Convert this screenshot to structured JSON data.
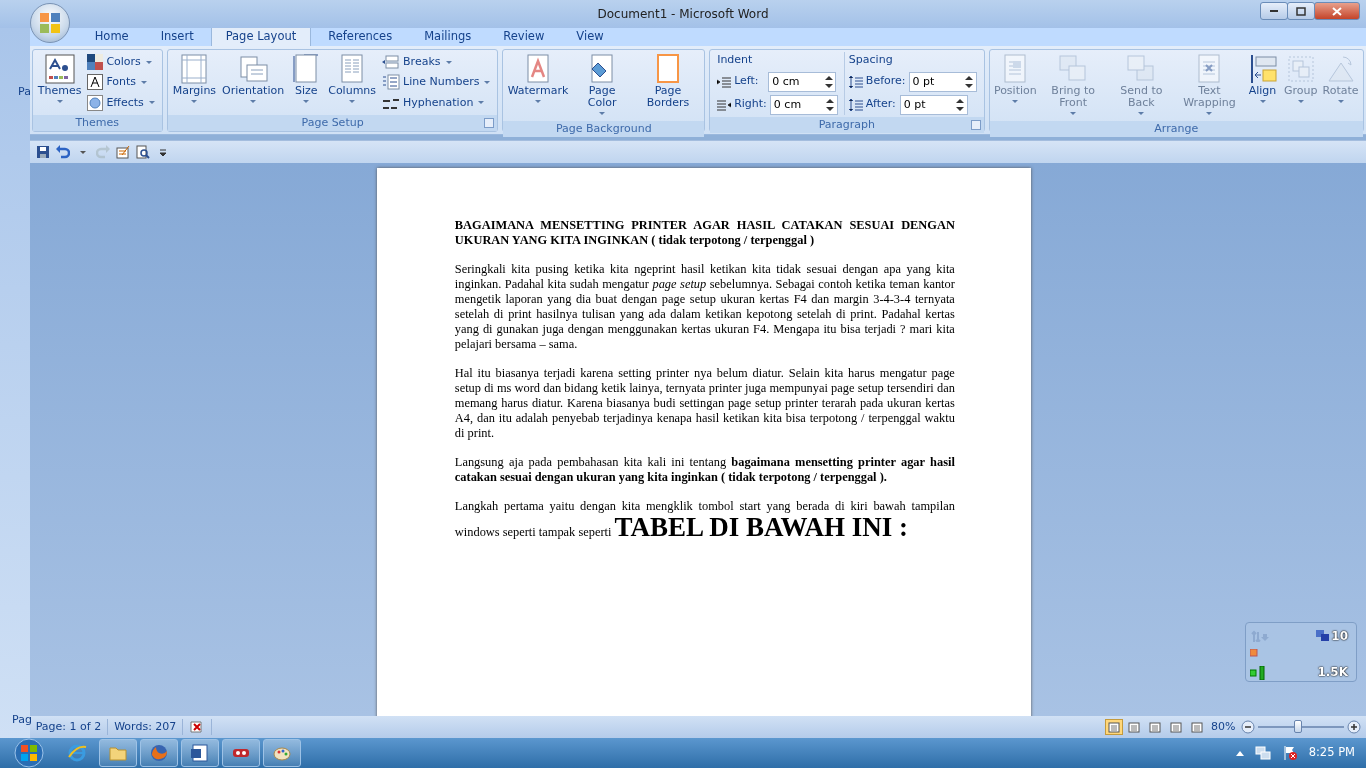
{
  "window": {
    "title": "Document1 - Microsoft Word"
  },
  "background_window": {
    "ribbon_text": "Pa",
    "status_text": "Pag"
  },
  "tabs": [
    {
      "label": "Home",
      "selected": false
    },
    {
      "label": "Insert",
      "selected": false
    },
    {
      "label": "Page Layout",
      "selected": true
    },
    {
      "label": "References",
      "selected": false
    },
    {
      "label": "Mailings",
      "selected": false
    },
    {
      "label": "Review",
      "selected": false
    },
    {
      "label": "View",
      "selected": false
    }
  ],
  "ribbon_groups": [
    {
      "label": "Themes",
      "launcher": false,
      "items": [
        {
          "kind": "large",
          "label": "Themes",
          "dropdown": true,
          "disabled": false
        },
        {
          "kind": "small",
          "label": "Colors",
          "dropdown": true,
          "disabled": false
        },
        {
          "kind": "small",
          "label": "Fonts",
          "dropdown": true,
          "disabled": false
        },
        {
          "kind": "small",
          "label": "Effects",
          "dropdown": true,
          "disabled": false
        }
      ]
    },
    {
      "label": "Page Setup",
      "launcher": true,
      "items": [
        {
          "kind": "large",
          "label": "Margins",
          "dropdown": true,
          "disabled": false
        },
        {
          "kind": "large",
          "label": "Orientation",
          "dropdown": true,
          "disabled": false
        },
        {
          "kind": "large",
          "label": "Size",
          "dropdown": true,
          "disabled": false
        },
        {
          "kind": "large",
          "label": "Columns",
          "dropdown": true,
          "disabled": false
        },
        {
          "kind": "small",
          "label": "Breaks",
          "dropdown": true,
          "disabled": false
        },
        {
          "kind": "small",
          "label": "Line Numbers",
          "dropdown": true,
          "disabled": false
        },
        {
          "kind": "small",
          "label": "Hyphenation",
          "dropdown": true,
          "disabled": false
        }
      ]
    },
    {
      "label": "Page Background",
      "launcher": false,
      "items": [
        {
          "kind": "large",
          "label": "Watermark",
          "dropdown": true,
          "disabled": false
        },
        {
          "kind": "large",
          "label": "Page Color",
          "dropdown": true,
          "disabled": false
        },
        {
          "kind": "large",
          "label": "Page Borders",
          "dropdown": false,
          "disabled": false
        }
      ]
    },
    {
      "label": "Paragraph",
      "launcher": true,
      "items": [
        {
          "kind": "spin_column",
          "heading": "Indent",
          "fields": [
            {
              "label": "Left:",
              "value": "0 cm"
            },
            {
              "label": "Right:",
              "value": "0 cm"
            }
          ]
        },
        {
          "kind": "spin_column",
          "heading": "Spacing",
          "fields": [
            {
              "label": "Before:",
              "value": "0 pt"
            },
            {
              "label": "After:",
              "value": "0 pt"
            }
          ]
        }
      ]
    },
    {
      "label": "Arrange",
      "launcher": false,
      "items": [
        {
          "kind": "large",
          "label": "Position",
          "dropdown": true,
          "disabled": true
        },
        {
          "kind": "large",
          "label": "Bring to Front",
          "dropdown": true,
          "disabled": true
        },
        {
          "kind": "large",
          "label": "Send to Back",
          "dropdown": true,
          "disabled": true
        },
        {
          "kind": "large",
          "label": "Text Wrapping",
          "dropdown": true,
          "disabled": true
        },
        {
          "kind": "large",
          "label": "Align",
          "dropdown": true,
          "disabled": false
        },
        {
          "kind": "large",
          "label": "Group",
          "dropdown": true,
          "disabled": true
        },
        {
          "kind": "large",
          "label": "Rotate",
          "dropdown": true,
          "disabled": true
        }
      ]
    }
  ],
  "quick_access": [
    {
      "kind": "save",
      "disabled": false
    },
    {
      "kind": "undo",
      "disabled": false
    },
    {
      "kind": "menu",
      "disabled": false
    },
    {
      "kind": "redo",
      "disabled": true
    },
    {
      "kind": "edit",
      "disabled": false
    },
    {
      "kind": "preview",
      "disabled": false
    },
    {
      "kind": "customize",
      "disabled": false
    }
  ],
  "document": {
    "paragraphs": [
      {
        "kind": "heading",
        "text": "BAGAIMANA MENSETTING PRINTER AGAR HASIL CATAKAN SESUAI DENGAN UKURAN YANG KITA INGINKAN ( tidak terpotong / terpenggal )"
      },
      {
        "kind": "body",
        "text": "Seringkali kita pusing ketika kita ngeprint hasil ketikan kita tidak sesuai dengan apa yang kita inginkan. Padahal kita sudah mengatur *page setup* sebelumnya. Sebagai contoh ketika teman kantor mengetik laporan yang dia buat dengan page setup ukuran kertas F4 dan margin 3-4-3-4 ternyata setelah di print hasilnya tulisan yang ada dalam ketikan kepotong setelah di print. Padahal kertas yang di gunakan juga dengan menggunakan kertas ukuran F4. Mengapa itu bisa terjadi ? mari kita pelajari bersama – sama."
      },
      {
        "kind": "body",
        "text": "Hal itu biasanya terjadi karena setting printer nya belum diatur. Selain kita harus mengatur page setup di ms word dan bidang ketik lainya, ternyata printer juga mempunyai page setup tersendiri dan memang harus diatur. Karena biasanya budi settingan page setup printer terarah pada ukuran kertas A4, dan itu adalah penyebab terjadinya kenapa hasil ketikan kita bisa terpotong / terpenggal waktu di print."
      },
      {
        "kind": "body",
        "text": "Langsung aja pada pembahasan kita kali ini tentang **bagaimana mensetting printer agar hasil catakan sesuai dengan ukuran yang kita inginkan ( tidak terpotong / terpenggal ).**"
      },
      {
        "kind": "body",
        "text": "Langkah pertama yaitu dengan kita mengklik tombol start yang berada di kiri bawah tampilan windows seperti tampak seperti",
        "large_tail": "TABEL DI BAWAH INI :"
      }
    ]
  },
  "status_bar": {
    "page": "Page: 1 of 2",
    "words": "Words: 207",
    "view_buttons": [
      {
        "selected": true
      },
      {
        "selected": false
      },
      {
        "selected": false
      },
      {
        "selected": false
      },
      {
        "selected": false
      }
    ],
    "zoom": "80%",
    "zoom_slider": {
      "level": 0.47
    }
  },
  "network_widget": {
    "top_value": "10",
    "bottom_value": "1.5K"
  },
  "taskbar": {
    "apps": [
      {
        "kind": "browser_e",
        "running": false
      },
      {
        "kind": "folder",
        "running": true
      },
      {
        "kind": "browser_fox",
        "running": true
      },
      {
        "kind": "document",
        "running": true
      },
      {
        "kind": "app",
        "running": true
      },
      {
        "kind": "palette",
        "running": true
      }
    ],
    "clock": "8:25 PM"
  }
}
